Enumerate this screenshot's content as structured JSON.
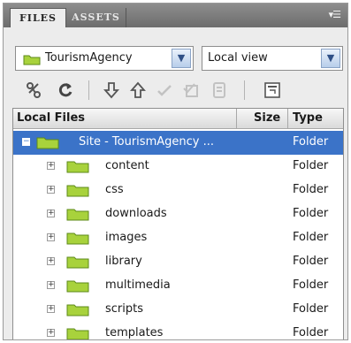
{
  "tabs": [
    {
      "label": "FILES",
      "active": true
    },
    {
      "label": "ASSETS",
      "active": false
    }
  ],
  "panel_menu_icon": "panel-options-icon",
  "site_selector": {
    "value": "TourismAgency",
    "icon": "site-folder-icon"
  },
  "view_selector": {
    "value": "Local view"
  },
  "toolbar": [
    {
      "name": "connect-icon",
      "enabled": true
    },
    {
      "name": "refresh-icon",
      "enabled": true
    },
    {
      "name": "get-files-icon",
      "enabled": true
    },
    {
      "name": "put-files-icon",
      "enabled": true
    },
    {
      "name": "check-out-icon",
      "enabled": false
    },
    {
      "name": "check-in-icon",
      "enabled": false
    },
    {
      "name": "synchronize-icon",
      "enabled": false
    },
    {
      "name": "expand-view-icon",
      "enabled": true
    }
  ],
  "file_list": {
    "headers": {
      "name": "Local Files",
      "size": "Size",
      "type": "Type"
    },
    "root": {
      "name": "Site - TourismAgency ...",
      "type": "Folder",
      "selected": true
    },
    "items": [
      {
        "name": "content",
        "type": "Folder"
      },
      {
        "name": "css",
        "type": "Folder"
      },
      {
        "name": "downloads",
        "type": "Folder"
      },
      {
        "name": "images",
        "type": "Folder"
      },
      {
        "name": "library",
        "type": "Folder"
      },
      {
        "name": "multimedia",
        "type": "Folder"
      },
      {
        "name": "scripts",
        "type": "Folder"
      },
      {
        "name": "templates",
        "type": "Folder"
      }
    ]
  },
  "colors": {
    "selection": "#3b73c8",
    "folder": "#a8d23c",
    "tab_strip": "#7c7c7c"
  }
}
